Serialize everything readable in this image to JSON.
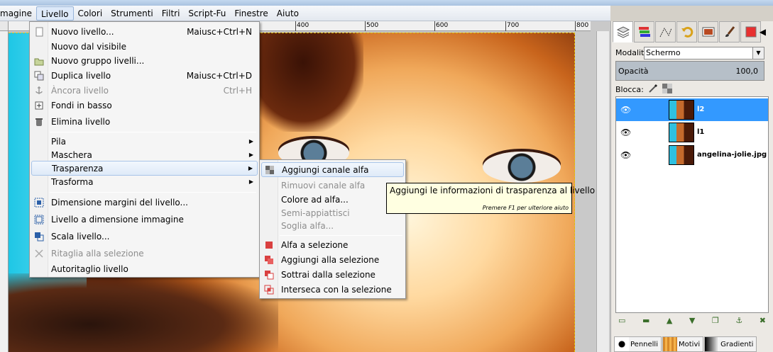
{
  "menubar": {
    "items": [
      "magine",
      "Livello",
      "Colori",
      "Strumenti",
      "Filtri",
      "Script-Fu",
      "Finestre",
      "Aiuto"
    ]
  },
  "rulers": {
    "top_ticks": [
      "400",
      "500",
      "600",
      "700",
      "800"
    ]
  },
  "livello_menu": {
    "items": [
      {
        "label": "Nuovo livello...",
        "shortcut": "Maiusc+Ctrl+N",
        "icon": "new-layer-icon",
        "disabled": false
      },
      {
        "label": "Nuovo dal visibile",
        "shortcut": "",
        "icon": "",
        "disabled": false
      },
      {
        "label": "Nuovo gruppo livelli...",
        "shortcut": "",
        "icon": "folder-icon",
        "disabled": false
      },
      {
        "label": "Duplica livello",
        "shortcut": "Maiusc+Ctrl+D",
        "icon": "duplicate-icon",
        "disabled": false
      },
      {
        "label": "Àncora livello",
        "shortcut": "Ctrl+H",
        "icon": "anchor-icon",
        "disabled": true
      },
      {
        "label": "Fondi in basso",
        "shortcut": "",
        "icon": "merge-down-icon",
        "disabled": false
      },
      {
        "label": "Elimina livello",
        "shortcut": "",
        "icon": "trash-icon",
        "disabled": false
      },
      {
        "label": "Pila",
        "submenu": true
      },
      {
        "label": "Maschera",
        "submenu": true
      },
      {
        "label": "Trasparenza",
        "submenu": true,
        "highlighted": true
      },
      {
        "label": "Trasforma",
        "submenu": true
      },
      {
        "label": "Dimensione margini del livello...",
        "icon": "layer-boundary-icon"
      },
      {
        "label": "Livello a dimensione immagine",
        "icon": "layer-to-image-icon"
      },
      {
        "label": "Scala livello...",
        "icon": "scale-icon"
      },
      {
        "label": "Ritaglia alla selezione",
        "icon": "crop-icon",
        "disabled": true
      },
      {
        "label": "Autoritaglio livello",
        "icon": ""
      }
    ]
  },
  "trasparenza_menu": {
    "items": [
      {
        "label": "Aggiungi canale alfa",
        "highlighted": true,
        "icon": "alpha-add-icon"
      },
      {
        "label": "Rimuovi canale alfa",
        "disabled": true
      },
      {
        "label": "Colore ad alfa..."
      },
      {
        "label": "Semi-appiattisci",
        "disabled": true
      },
      {
        "label": "Soglia alfa...",
        "disabled": true
      },
      {
        "label": "Alfa a selezione",
        "icon": "alpha-to-selection-icon"
      },
      {
        "label": "Aggiungi alla selezione",
        "icon": "add-selection-icon"
      },
      {
        "label": "Sottrai dalla selezione",
        "icon": "subtract-selection-icon"
      },
      {
        "label": "Interseca con la selezione",
        "icon": "intersect-selection-icon"
      }
    ]
  },
  "tooltip": {
    "text": "Aggiungi le informazioni di trasparenza al livello",
    "hint": "Premere F1 per ulteriore aiuto"
  },
  "layers_panel": {
    "mode_label": "Modalità:",
    "mode_value": "Schermo",
    "opacity_label": "Opacità",
    "opacity_value": "100,0",
    "lock_label": "Blocca:",
    "layers": [
      {
        "name": "l2",
        "selected": true
      },
      {
        "name": "l1",
        "selected": false
      },
      {
        "name": "angelina-jolie.jpg",
        "selected": false
      }
    ],
    "bottom_tabs": [
      "Pennelli",
      "Motivi",
      "Gradienti"
    ]
  },
  "colors": {
    "highlight": "#3399ff",
    "tooltip_bg": "#ffffe1",
    "menu_bg": "#f5f5f5"
  }
}
